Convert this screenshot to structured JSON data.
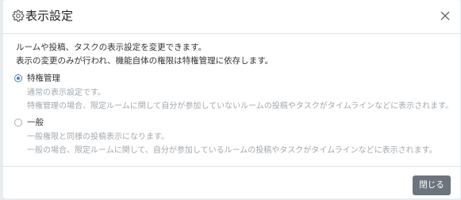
{
  "dialog": {
    "title": "表示設定",
    "header_icon": "gear-icon",
    "close_icon": "close-icon"
  },
  "body": {
    "description_line1": "ルームや投稿、タスクの表示設定を変更できます。",
    "description_line2": "表示の変更のみが行われ、機能自体の権限は特権管理に依存します。"
  },
  "options": [
    {
      "label": "特権管理",
      "selected": true,
      "sub1": "通常の表示設定です。",
      "sub2": "特権管理の場合、限定ルームに関して自分が参加していないルームの投稿やタスクがタイムラインなどに表示されます。"
    },
    {
      "label": "一般",
      "selected": false,
      "sub1": "一般権限と同様の投稿表示になります。",
      "sub2": "一般の場合、限定ルームに関して、自分が参加しているルームの投稿やタスクがタイムラインなどに表示されます。"
    }
  ],
  "footer": {
    "close_label": "閉じる"
  },
  "colors": {
    "accent": "#3b7ddd",
    "button_bg": "#6c757d",
    "muted_text": "#a3a8ad"
  }
}
